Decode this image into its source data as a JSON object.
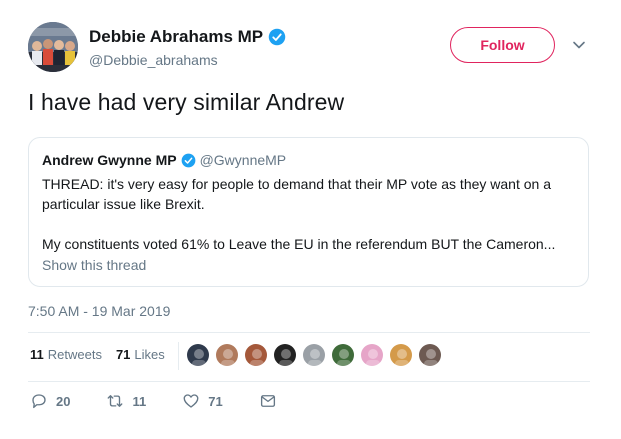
{
  "author": {
    "display_name": "Debbie Abrahams MP",
    "handle": "@Debbie_abrahams",
    "avatar_icon": "group-photo-avatar",
    "verified_icon": "verified-badge-icon"
  },
  "follow_label": "Follow",
  "tweet_text": "I have had very similar Andrew",
  "quoted_tweet": {
    "display_name": "Andrew Gwynne MP",
    "handle": "@GwynneMP",
    "lines": [
      "THREAD: it's very easy for people to demand that their MP vote as they want on a",
      "particular issue like Brexit.",
      "My constituents voted 61% to Leave the EU in the referendum BUT the Cameron..."
    ],
    "show_thread": "Show this thread"
  },
  "timestamp": "7:50 AM - 19 Mar 2019",
  "stats": {
    "retweets_count": "11",
    "retweets_label": "Retweets",
    "likes_count": "71",
    "likes_label": "Likes"
  },
  "liker_avatars": [
    "#2f3a4c",
    "#b07a5c",
    "#a4583a",
    "#222222",
    "#9aa0a6",
    "#3f6b3a",
    "#e6a5c8",
    "#d49a4a",
    "#6d5a52"
  ],
  "actions": {
    "reply_count": "20",
    "retweet_count": "11",
    "like_count": "71"
  },
  "colors": {
    "follow_accent": "#e0245e",
    "verified_blue": "#1da1f2",
    "secondary_text": "#657786"
  }
}
